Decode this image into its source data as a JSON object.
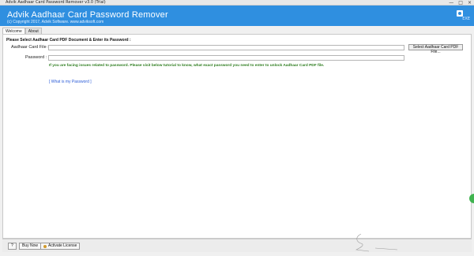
{
  "window": {
    "title": "Advik Aadhaar Card Password Remover v3.0 (Trial)",
    "controls": [
      "—",
      "□",
      "×"
    ]
  },
  "banner": {
    "title": "Advik Aadhaar Card Password Remover",
    "copyright": "(c) Copyright 2017, Advik Software. www.adviksoft.com",
    "link": "EXE"
  },
  "tabs": [
    {
      "label": "Welcome",
      "active": true
    },
    {
      "label": "About",
      "active": false
    }
  ],
  "form": {
    "section_title": "Please Select Aadhaar Card PDF Document &  Enter its Password :",
    "file_label": "Aadhaar Card File :",
    "file_value": "",
    "password_label": "Password :",
    "password_value": "",
    "browse_button": "Select Aadhaar Card PDF File...",
    "help_text": "If you are facing issues related to password. Please visit below tutorial to know, what exact password you need to enter to unlock Aadhaar Card PDF file.",
    "link_text": "[ What is my Password ]"
  },
  "footer": {
    "help_button": "?",
    "buy_button": "Buy Now",
    "activate_button": "Activate License"
  },
  "colors": {
    "banner": "#2f8fe0",
    "help_text": "#2e7d1f",
    "link": "#2a5bd7"
  },
  "icons": {
    "banner": "settings-icon",
    "activate": "key-icon"
  }
}
